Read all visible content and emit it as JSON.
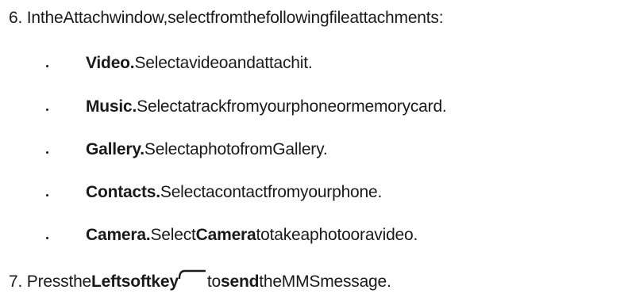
{
  "step6": {
    "number": "6.",
    "text": "IntheAttachwindow,selectfromthefollowingfileattachments:"
  },
  "bullets": [
    {
      "term": "Video.",
      "desc": "Selectavideoandattachit."
    },
    {
      "term": "Music.",
      "desc": "Selectatrackfromyourphoneormemorycard."
    },
    {
      "term": "Gallery.",
      "desc": "SelectaphotofromGallery."
    },
    {
      "term": "Contacts.",
      "desc": "Selectacontactfromyourphone."
    },
    {
      "term": "Camera.",
      "desc_pre": "Select",
      "desc_bold": "Camera",
      "desc_post": "totakeaphotooravideo."
    }
  ],
  "step7": {
    "number": "7.",
    "pre": "Pressthe",
    "bold1": "Leftsoftkey",
    "icon": "left-softkey-icon",
    "mid": "to",
    "bold2": "send",
    "post": "theMMSmessage."
  },
  "colors": {
    "text": "#1a1a1a",
    "background": "#ffffff"
  }
}
